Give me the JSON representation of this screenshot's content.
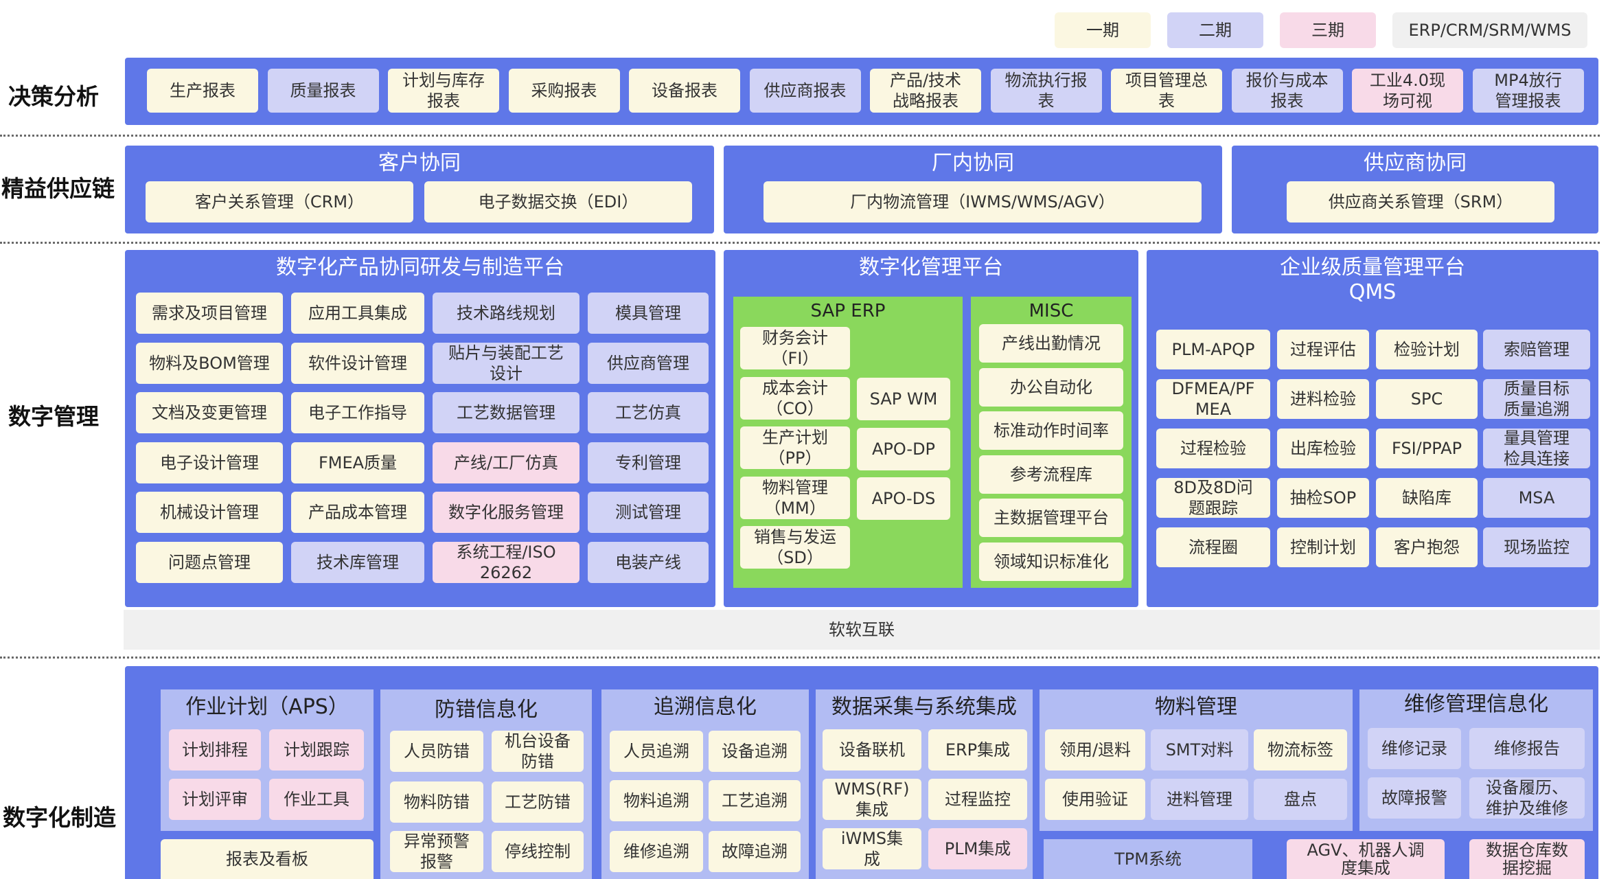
{
  "legend": {
    "p1": "一期",
    "p2": "二期",
    "p3": "三期",
    "p4": "ERP/CRM/SRM/WMS"
  },
  "rows": {
    "decision": "决策分析",
    "supply": "精益供应链",
    "digital": "数字管理",
    "manufacturing": "数字化制造"
  },
  "decision": [
    "生产报表",
    "质量报表",
    "计划与库存\n报表",
    "采购报表",
    "设备报表",
    "供应商报表",
    "产品/技术\n战略报表",
    "物流执行报\n表",
    "项目管理总\n表",
    "报价与成本\n报表",
    "工业4.0现\n场可视",
    "MP4放行\n管理报表"
  ],
  "supply": {
    "customer": {
      "title": "客户协同",
      "items": [
        "客户关系管理（CRM）",
        "电子数据交换（EDI）"
      ]
    },
    "factory": {
      "title": "厂内协同",
      "items": [
        "厂内物流管理（IWMS/WMS/AGV）"
      ]
    },
    "supplier": {
      "title": "供应商协同",
      "items": [
        "供应商关系管理（SRM）"
      ]
    }
  },
  "rd": {
    "title": "数字化产品协同研发与制造平台",
    "items": [
      "需求及项目管理",
      "应用工具集成",
      "技术路线规划",
      "模具管理",
      "物料及BOM管理",
      "软件设计管理",
      "贴片与装配工艺\n设计",
      "供应商管理",
      "文档及变更管理",
      "电子工作指导",
      "工艺数据管理",
      "工艺仿真",
      "电子设计管理",
      "FMEA质量",
      "产线/工厂仿真",
      "专利管理",
      "机械设计管理",
      "产品成本管理",
      "数字化服务管理",
      "测试管理",
      "问题点管理",
      "技术库管理",
      "系统工程/ISO\n26262",
      "电装产线"
    ]
  },
  "mgmt": {
    "title": "数字化管理平台",
    "sap": {
      "title": "SAP ERP",
      "left": [
        "财务会计\n（FI）",
        "成本会计\n（CO）",
        "生产计划\n（PP）",
        "物料管理\n（MM）",
        "销售与发运\n（SD）"
      ],
      "right": [
        "SAP WM",
        "APO-DP",
        "APO-DS"
      ]
    },
    "misc": {
      "title": "MISC",
      "items": [
        "产线出勤情况",
        "办公自动化",
        "标准动作时间率",
        "参考流程库",
        "主数据管理平台",
        "领域知识标准化"
      ]
    }
  },
  "qms": {
    "title": "企业级质量管理平台\nQMS",
    "items": [
      "PLM-APQP",
      "过程评估",
      "检验计划",
      "索赔管理",
      "DFMEA/PF\nMEA",
      "进料检验",
      "SPC",
      "质量目标\n质量追溯",
      "过程检验",
      "出库检验",
      "FSI/PPAP",
      "量具管理\n检具连接",
      "8D及8D问\n题跟踪",
      "抽检SOP",
      "缺陷库",
      "MSA",
      "流程圈",
      "控制计划",
      "客户抱怨",
      "现场监控"
    ]
  },
  "soft": "软软互联",
  "mfg": {
    "aps": {
      "title": "作业计划（APS）",
      "items": [
        "计划排程",
        "计划跟踪",
        "计划评审",
        "作业工具"
      ],
      "report": "报表及看板"
    },
    "mistake": {
      "title": "防错信息化",
      "items": [
        "人员防错",
        "机台设备\n防错",
        "物料防错",
        "工艺防错",
        "异常预警\n报警",
        "停线控制"
      ]
    },
    "trace": {
      "title": "追溯信息化",
      "items": [
        "人员追溯",
        "设备追溯",
        "物料追溯",
        "工艺追溯",
        "维修追溯",
        "故障追溯"
      ]
    },
    "data": {
      "title": "数据采集与系统集成",
      "items": [
        "设备联机",
        "ERP集成",
        "WMS(RF)\n集成",
        "过程监控",
        "iWMS集\n成",
        "PLM集成"
      ]
    },
    "material": {
      "title": "物料管理",
      "items": [
        "领用/退料",
        "SMT对料",
        "物流标签",
        "使用验证",
        "进料管理",
        "盘点"
      ],
      "tpm": "TPM系统"
    },
    "repair": {
      "title": "维修管理信息化",
      "items": [
        "维修记录",
        "维修报告",
        "故障报警",
        "设备履历、\n维护及维修"
      ],
      "agv": "AGV、机器人调\n度集成",
      "dw": "数据仓库数\n据挖掘"
    }
  },
  "colors": {
    "panel": "#5F77E8",
    "sub": "#B2BCF3",
    "green": "#8AD85C",
    "p1": "#FBF7E1",
    "p2": "#D1D3F6",
    "p3": "#F8DAE8"
  }
}
